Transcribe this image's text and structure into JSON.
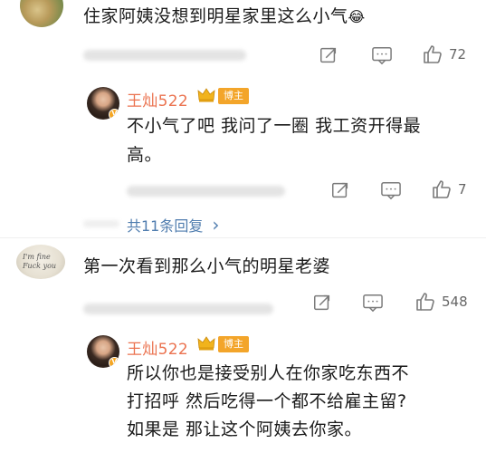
{
  "comments": [
    {
      "text": "住家阿姨没想到明星家里这么小气",
      "emoji": "😂",
      "likes": "72"
    },
    {
      "text": "第一次看到那么小气的明星老婆",
      "avatar_text_line1": "I'm fine",
      "avatar_text_line2": "Fuck you",
      "likes": "548"
    }
  ],
  "replies": [
    {
      "username": "王灿522",
      "badge": "博主",
      "text_line1": "不小气了吧 我问了一圈 我工资开得最",
      "text_line2": "高。",
      "likes": "7"
    },
    {
      "username": "王灿522",
      "badge": "博主",
      "text_line1": "所以你也是接受别人在你家吃东西不",
      "text_line2": "打招呼 然后吃得一个都不给雇主留?",
      "text_line3": "如果是 那让这个阿姨去你家。"
    }
  ],
  "more_replies": {
    "label": "共11条回复",
    "chevron": "›"
  },
  "icons": {
    "share": "share-icon",
    "comment": "comment-icon",
    "like": "like-icon",
    "crown": "crown-icon"
  },
  "colors": {
    "username": "#eb7350",
    "badge": "#f3a52a",
    "link": "#507daf"
  }
}
